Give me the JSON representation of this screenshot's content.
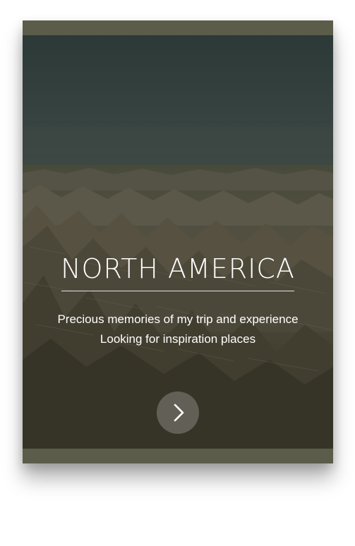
{
  "hero": {
    "title": "NORTH AMERICA",
    "subtitle_line1": "Precious memories of my trip and experience",
    "subtitle_line2": "Looking for inspiration places"
  },
  "next_button": {
    "icon": "chevron-right-icon"
  },
  "colors": {
    "frame": "#5c5c4b",
    "sky": "#394b4a",
    "text": "#ffffff"
  }
}
